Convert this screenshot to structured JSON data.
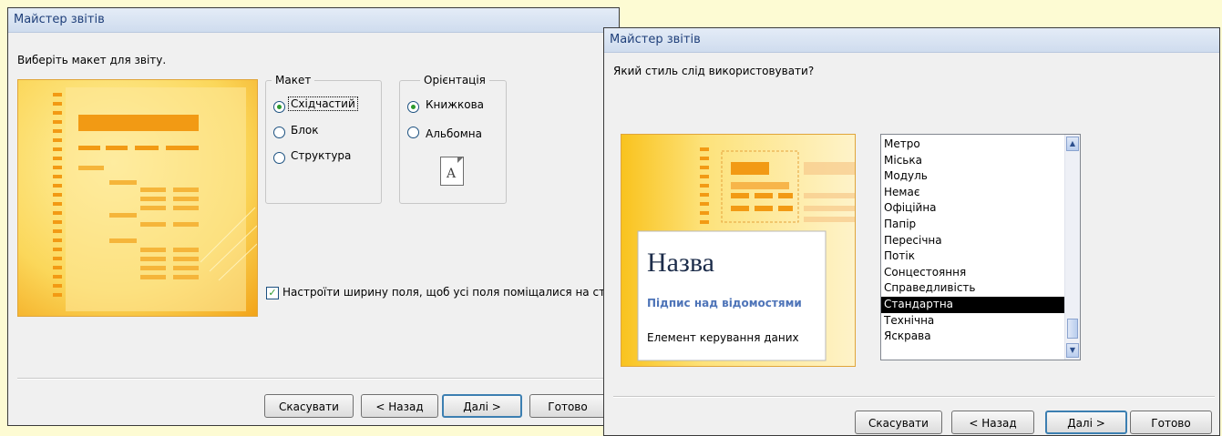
{
  "left": {
    "title": "Майстер звітів",
    "prompt": "Виберіть макет для звіту.",
    "layout_group": {
      "legend": "Макет",
      "options": [
        "Східчастий",
        "Блок",
        "Структура"
      ],
      "selected": 0
    },
    "orientation_group": {
      "legend": "Орієнтація",
      "options": [
        "Книжкова",
        "Альбомна"
      ],
      "selected": 0,
      "page_letter": "A"
    },
    "fit_checkbox": {
      "label": "Настроїти ширину поля, щоб усі поля поміщалися на сторінці",
      "checked": true,
      "mark": "✓"
    },
    "buttons": {
      "cancel": "Скасувати",
      "back": "< Назад",
      "next": "Далі >",
      "finish": "Готово"
    }
  },
  "right": {
    "title": "Майстер звітів",
    "prompt": "Який стиль слід використовувати?",
    "preview": {
      "title": "Назва",
      "subtitle": "Підпис над відомостями",
      "control": "Елемент керування даних"
    },
    "styles": [
      "Метро",
      "Міська",
      "Модуль",
      "Немає",
      "Офіційна",
      "Папір",
      "Пересічна",
      "Потік",
      "Сонцестояння",
      "Справедливість",
      "Стандартна",
      "Технічна",
      "Яскрава"
    ],
    "selected_style": "Стандартна",
    "scroll_up": "▲",
    "scroll_down": "▼",
    "buttons": {
      "cancel": "Скасувати",
      "back": "< Назад",
      "next": "Далі >",
      "finish": "Готово"
    }
  },
  "colors": {
    "background": "#fdfbd3",
    "preview_orange": "#f2a216",
    "preview_yellow": "#fbd75a",
    "title_text": "#1f3f7a"
  }
}
